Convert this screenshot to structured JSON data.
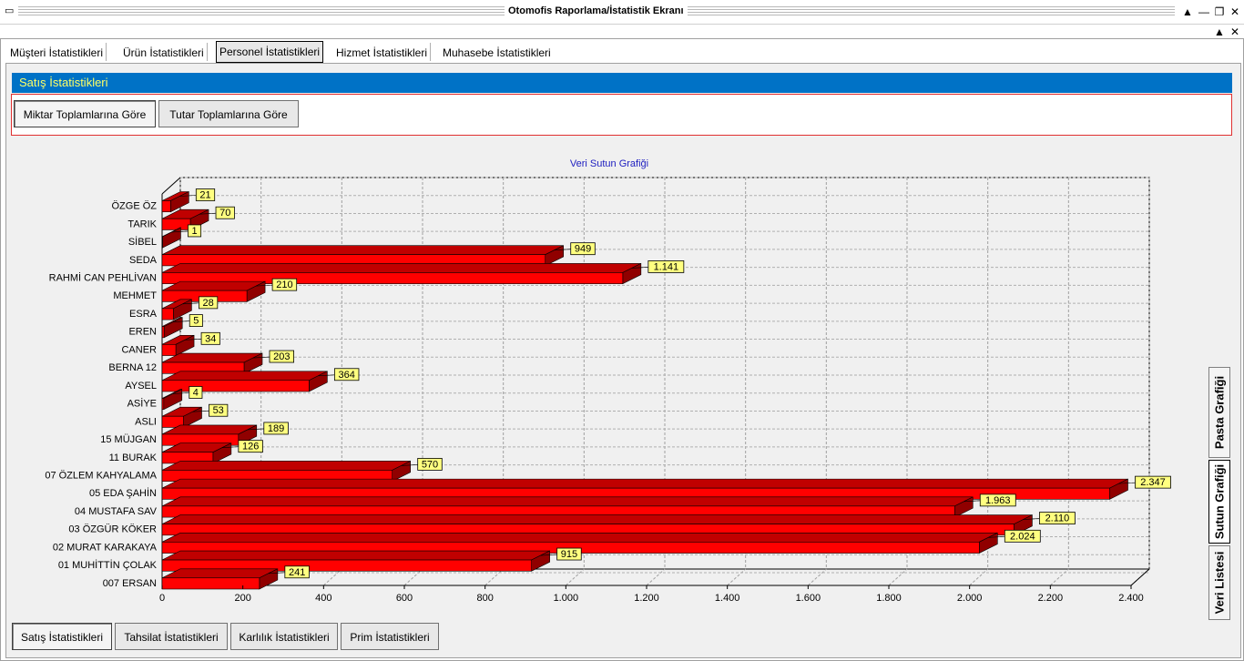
{
  "window": {
    "title": "Otomofis Raporlama/İstatistik Ekranı",
    "controls": [
      "▲",
      "—",
      "❐",
      "✕"
    ],
    "mdi_controls": [
      "▲",
      "✕"
    ]
  },
  "top_tabs": [
    {
      "label": "Müşteri İstatistikleri",
      "active": false
    },
    {
      "label": "Ürün İstatistikleri",
      "active": false
    },
    {
      "label": "Personel İstatistikleri",
      "active": true
    },
    {
      "label": "Hizmet İstatistikleri",
      "active": false
    },
    {
      "label": "Muhasebe İstatistikleri",
      "active": false
    }
  ],
  "section_title": "Satış İstatistikleri",
  "mode_buttons": [
    {
      "label": "Miktar Toplamlarına Göre",
      "active": true
    },
    {
      "label": "Tutar Toplamlarına Göre",
      "active": false
    }
  ],
  "side_tabs": [
    {
      "label": "Pasta Grafiği",
      "active": false
    },
    {
      "label": "Sutun Grafiği",
      "active": true
    },
    {
      "label": "Veri Listesi",
      "active": false
    }
  ],
  "bottom_tabs": [
    {
      "label": "Satış İstatistikleri",
      "active": true
    },
    {
      "label": "Tahsilat İstatistikleri",
      "active": false
    },
    {
      "label": "Karlılık İstatistikleri",
      "active": false
    },
    {
      "label": "Prim İstatistikleri",
      "active": false
    }
  ],
  "colors": {
    "accent_bar": "#0072c6",
    "accent_text": "#ffff66",
    "bar_front": "#ff0000",
    "bar_top": "#c00000",
    "label_bg": "#ffff80"
  },
  "chart_data": {
    "type": "bar",
    "orientation": "horizontal",
    "title": "Veri Sutun Grafiği",
    "categories": [
      "ÖZGE ÖZ",
      "TARIK",
      "SİBEL",
      "SEDA",
      "RAHMİ CAN PEHLİVAN",
      "MEHMET",
      "ESRA",
      "EREN",
      "CANER",
      "BERNA 12",
      "AYSEL",
      "ASİYE",
      "ASLI",
      "15 MÜJGAN",
      "11 BURAK",
      "07 ÖZLEM KAHYALAMA",
      "05 EDA ŞAHİN",
      "04 MUSTAFA SAV",
      "03 ÖZGÜR KÖKER",
      "02 MURAT KARAKAYA",
      "01 MUHİTTİN ÇOLAK",
      "007 ERSAN"
    ],
    "values": [
      21,
      70,
      1,
      949,
      1141,
      210,
      28,
      5,
      34,
      203,
      364,
      4,
      53,
      189,
      126,
      570,
      2347,
      1963,
      2110,
      2024,
      915,
      241
    ],
    "value_labels": [
      "21",
      "70",
      "1",
      "949",
      "1.141",
      "210",
      "28",
      "5",
      "34",
      "203",
      "364",
      "4",
      "53",
      "189",
      "126",
      "570",
      "2.347",
      "1.963",
      "2.110",
      "2.024",
      "915",
      "241"
    ],
    "xlim": [
      0,
      2400
    ],
    "x_ticks": [
      0,
      200,
      400,
      600,
      800,
      1000,
      1200,
      1400,
      1600,
      1800,
      2000,
      2200,
      2400
    ],
    "x_tick_labels": [
      "0",
      "200",
      "400",
      "600",
      "800",
      "1.000",
      "1.200",
      "1.400",
      "1.600",
      "1.800",
      "2.000",
      "2.200",
      "2.400"
    ],
    "grid": true,
    "style": "3d"
  }
}
